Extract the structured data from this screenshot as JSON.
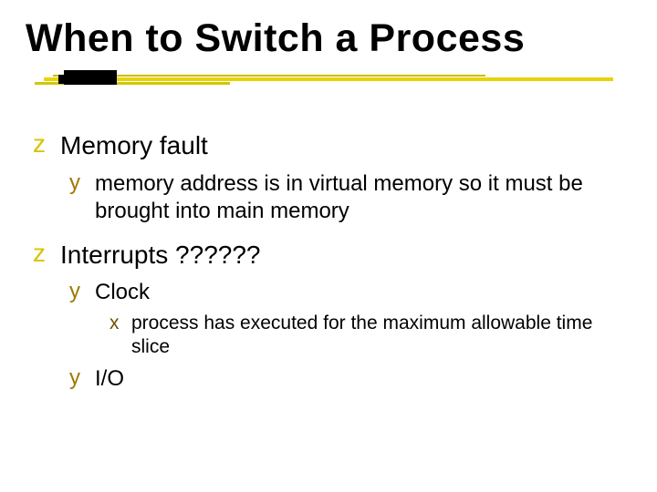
{
  "title": "When to Switch a Process",
  "glyphs": {
    "l1": "z",
    "l2": "y",
    "l3": "x"
  },
  "items": [
    {
      "text": "Memory fault",
      "children": [
        {
          "text": "memory address is in virtual memory so it must be brought into main memory",
          "children": []
        }
      ]
    },
    {
      "text": "Interrupts ??????",
      "children": [
        {
          "text": "Clock",
          "children": [
            {
              "text": "process has executed for the maximum allowable time slice"
            }
          ]
        },
        {
          "text": "I/O",
          "children": []
        }
      ]
    }
  ]
}
